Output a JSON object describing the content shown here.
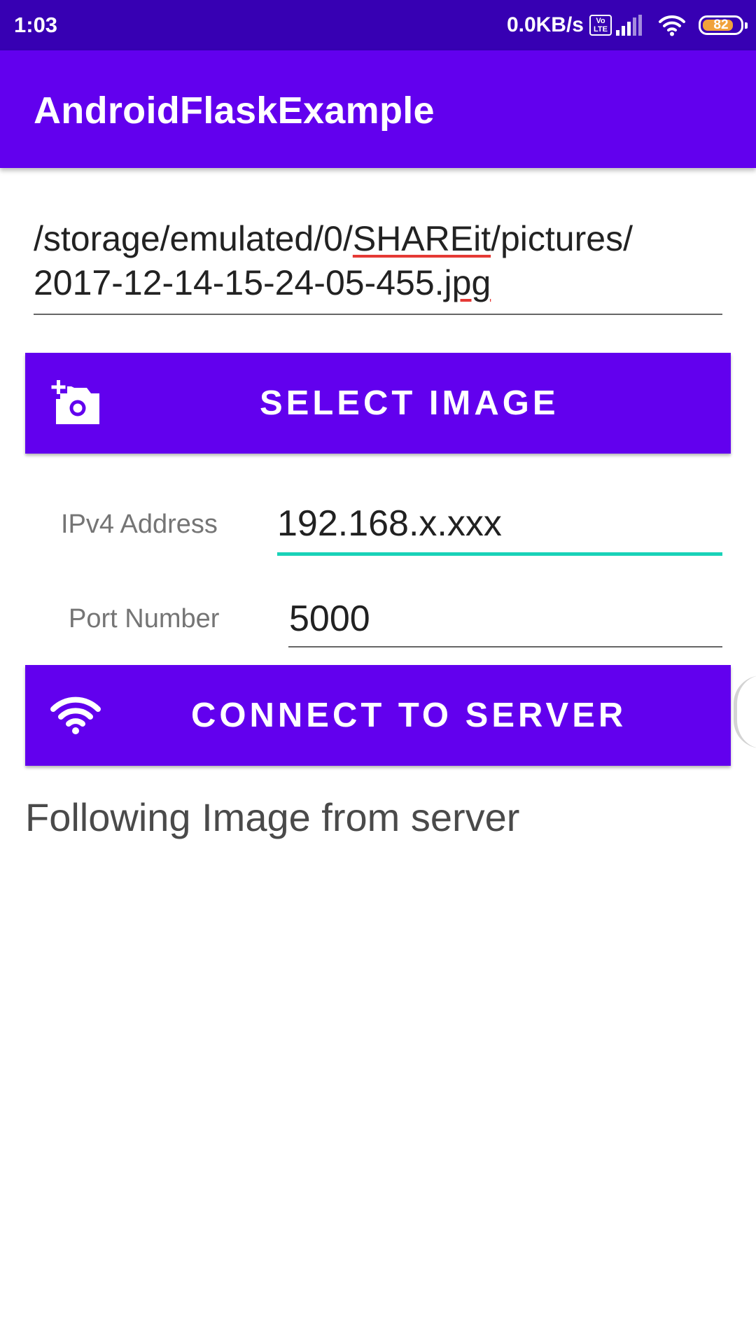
{
  "status_bar": {
    "time": "1:03",
    "net_speed": "0.0KB/s",
    "volte_top": "Vo",
    "volte_bottom": "LTE",
    "battery_level": "82",
    "battery_fraction": 0.82,
    "signal_icon": "cell-signal-icon",
    "wifi_icon": "wifi-icon",
    "battery_color": "#f0a23b"
  },
  "app_bar": {
    "title": "AndroidFlaskExample",
    "color": "#6200ee"
  },
  "image_path": {
    "line1_before": "/storage/emulated/0/",
    "line1_flagged": "SHAREit",
    "line1_after": "/pictures/",
    "line2_before": "2017-12-14-15-24-05-455.",
    "line2_flagged": "jpg"
  },
  "select_button": {
    "label": "SELECT IMAGE",
    "icon": "add-a-photo-icon"
  },
  "ipv4": {
    "label": "IPv4 Address",
    "value": "192.168.x.xxx",
    "focused": true,
    "accent": "#19d2b8"
  },
  "port": {
    "label": "Port Number",
    "value": "5000"
  },
  "connect_button": {
    "label": "CONNECT TO SERVER",
    "icon": "wifi-icon"
  },
  "response": {
    "text": "Following Image from server"
  }
}
